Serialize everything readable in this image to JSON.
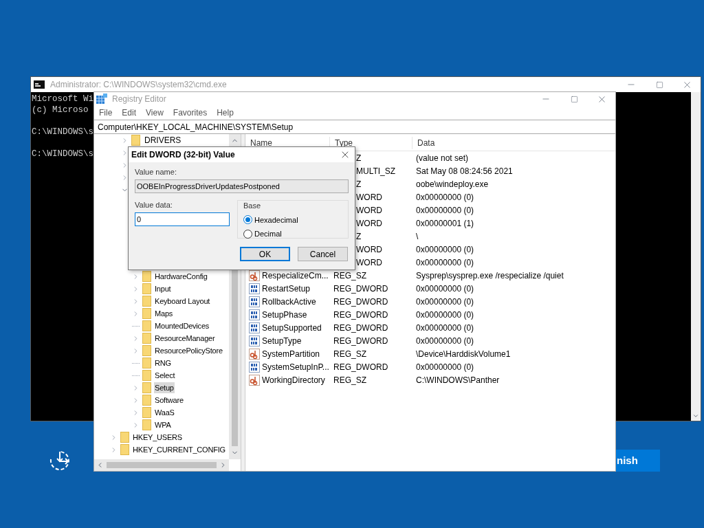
{
  "desktop": {
    "finish_button": "nish"
  },
  "cmd": {
    "title": "Administrator: C:\\WINDOWS\\system32\\cmd.exe",
    "blocks": [
      [
        "Microsoft Wi",
        "(c) Microso"
      ],
      [
        "C:\\WINDOWS\\s"
      ],
      [
        "C:\\WINDOWS\\s"
      ]
    ]
  },
  "regedit": {
    "title": "Registry Editor",
    "menu": [
      "File",
      "Edit",
      "View",
      "Favorites",
      "Help"
    ],
    "address": "Computer\\HKEY_LOCAL_MACHINE\\SYSTEM\\Setup",
    "tree": [
      {
        "label": "DRIVERS",
        "expanded": false,
        "selected": false
      },
      {
        "expanded": false
      },
      {
        "expanded": false
      },
      {
        "expanded": false
      },
      {
        "expanded": true,
        "children": [
          {
            "label": "HardwareConfig",
            "expandable": true,
            "selected": false
          },
          {
            "label": "Input",
            "expandable": true,
            "selected": false
          },
          {
            "label": "Keyboard Layout",
            "expandable": true,
            "selected": false
          },
          {
            "label": "Maps",
            "expandable": true,
            "selected": false
          },
          {
            "label": "MountedDevices",
            "expandable": false,
            "selected": false
          },
          {
            "label": "ResourceManager",
            "expandable": true,
            "selected": false
          },
          {
            "label": "ResourcePolicyStore",
            "expandable": true,
            "selected": false
          },
          {
            "label": "RNG",
            "expandable": false,
            "selected": false
          },
          {
            "label": "Select",
            "expandable": false,
            "selected": false
          },
          {
            "label": "Setup",
            "expandable": true,
            "selected": true
          },
          {
            "label": "Software",
            "expandable": true,
            "selected": false
          },
          {
            "label": "WaaS",
            "expandable": true,
            "selected": false
          },
          {
            "label": "WPA",
            "expandable": true,
            "selected": false
          }
        ]
      }
    ],
    "tree_roots": [
      {
        "label": "HKEY_USERS",
        "expanded": false,
        "selected": false
      },
      {
        "label": "HKEY_CURRENT_CONFIG",
        "expanded": false,
        "selected": false
      }
    ],
    "columns": [
      "Name",
      "Type",
      "Data"
    ],
    "rows": [
      {
        "type": "Z",
        "data": "(value not set)"
      },
      {
        "type": "MULTI_SZ",
        "data": "Sat May 08 08:24:56 2021"
      },
      {
        "type": "Z",
        "data": "oobe\\windeploy.exe"
      },
      {
        "type": "WORD",
        "data": "0x00000000 (0)"
      },
      {
        "type": "WORD",
        "data": "0x00000000 (0)"
      },
      {
        "type": "WORD",
        "data": "0x00000001 (1)"
      },
      {
        "type": "Z",
        "data": "\\"
      },
      {
        "type": "WORD",
        "data": "0x00000000 (0)"
      },
      {
        "type": "WORD",
        "data": "0x00000000 (0)"
      },
      {
        "kind": "sz",
        "name": "RespecializeCm...",
        "type": "REG_SZ",
        "data": "Sysprep\\sysprep.exe /respecialize /quiet"
      },
      {
        "kind": "dword",
        "name": "RestartSetup",
        "type": "REG_DWORD",
        "data": "0x00000000 (0)"
      },
      {
        "kind": "dword",
        "name": "RollbackActive",
        "type": "REG_DWORD",
        "data": "0x00000000 (0)"
      },
      {
        "kind": "dword",
        "name": "SetupPhase",
        "type": "REG_DWORD",
        "data": "0x00000000 (0)"
      },
      {
        "kind": "dword",
        "name": "SetupSupported",
        "type": "REG_DWORD",
        "data": "0x00000000 (0)"
      },
      {
        "kind": "dword",
        "name": "SetupType",
        "type": "REG_DWORD",
        "data": "0x00000000 (0)"
      },
      {
        "kind": "sz",
        "name": "SystemPartition",
        "type": "REG_SZ",
        "data": "\\Device\\HarddiskVolume1"
      },
      {
        "kind": "dword",
        "name": "SystemSetupInP...",
        "type": "REG_DWORD",
        "data": "0x00000000 (0)"
      },
      {
        "kind": "sz",
        "name": "WorkingDirectory",
        "type": "REG_SZ",
        "data": "C:\\WINDOWS\\Panther"
      }
    ]
  },
  "dialog": {
    "title": "Edit DWORD (32-bit) Value",
    "value_name_label": "Value name:",
    "value_name": "OOBEInProgressDriverUpdatesPostponed",
    "value_data_label": "Value data:",
    "value_data": "0",
    "base_label": "Base",
    "base": [
      {
        "label": "Hexadecimal",
        "selected": true
      },
      {
        "label": "Decimal",
        "selected": false
      }
    ],
    "buttons": [
      {
        "label": "OK",
        "default": true
      },
      {
        "label": "Cancel",
        "default": false
      }
    ]
  }
}
